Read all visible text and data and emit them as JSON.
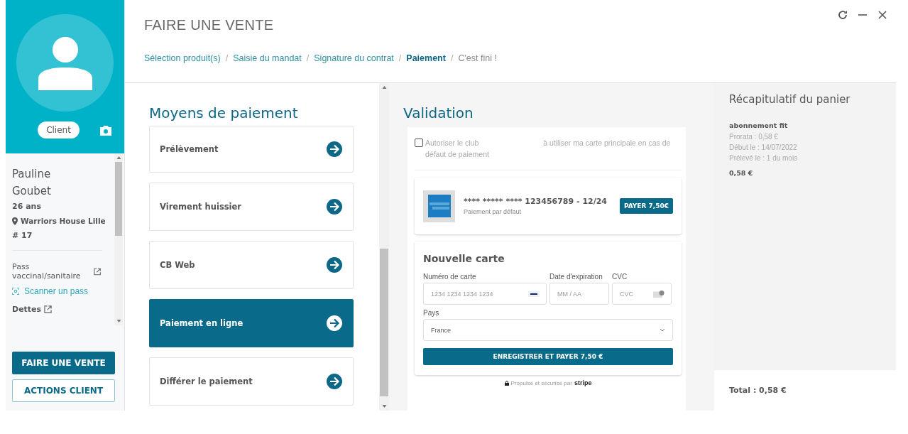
{
  "sidebar": {
    "profile_tag": "Client",
    "client": {
      "first_name": "Pauline",
      "last_name": "Goubet",
      "age": "26 ans",
      "club": "Warriors House Lille",
      "number": "# 17"
    },
    "pass": {
      "label": "Pass vaccinal/sanitaire",
      "action": "Scanner un pass"
    },
    "debts": {
      "label": "Dettes"
    },
    "buttons": [
      {
        "label": "FAIRE UNE VENTE",
        "kind": "primary"
      },
      {
        "label": "ACTIONS CLIENT",
        "kind": "outline"
      }
    ]
  },
  "header": {
    "title": "FAIRE UNE VENTE",
    "separator": "/",
    "breadcrumb": [
      {
        "label": "Sélection produit(s)",
        "kind": "done"
      },
      {
        "label": "Saisie du mandat",
        "kind": "done"
      },
      {
        "label": "Signature du contrat",
        "kind": "done"
      },
      {
        "label": "Paiement",
        "kind": "current"
      },
      {
        "label": "C'est fini !",
        "kind": "upcoming"
      }
    ]
  },
  "payment_methods": {
    "title": "Moyens de paiement",
    "items": [
      {
        "label": "Prélèvement",
        "selected": false
      },
      {
        "label": "Virement huissier",
        "selected": false
      },
      {
        "label": "CB Web",
        "selected": false
      },
      {
        "label": "Paiement en ligne",
        "selected": true
      },
      {
        "label": "Différer le paiement",
        "selected": false
      }
    ]
  },
  "validation": {
    "title": "Validation",
    "consent": {
      "checked": false,
      "text_before": "Autoriser le club",
      "text_after": "à utiliser ma carte principale en cas de défaut de paiement"
    },
    "saved_card": {
      "number": "**** ***** **** 123456789 - 12/24",
      "note": "Paiement par défaut",
      "pay_button": "PAYER 7,50€"
    },
    "new_card": {
      "title": "Nouvelle carte",
      "card_number": {
        "label": "Numéro de carte",
        "placeholder": "1234 1234 1234 1234"
      },
      "expiry": {
        "label": "Date d'expiration",
        "placeholder": "MM / AA"
      },
      "cvc": {
        "label": "CVC",
        "placeholder": "CVC"
      },
      "country": {
        "label": "Pays",
        "value": "France"
      },
      "submit": "ENREGISTRER ET PAYER 7,50 €"
    },
    "powered_by": "Propulsé et sécurisé par",
    "provider": "stripe"
  },
  "cart": {
    "title": "Récapitulatif du panier",
    "items": [
      {
        "name": "abonnement fit",
        "lines": [
          "Prorata : 0,58 €",
          "Début le : 14/07/2022",
          "Prélevé le : 1 du mois"
        ],
        "price": "0,58 €"
      }
    ],
    "total": "Total : 0,58 €"
  }
}
